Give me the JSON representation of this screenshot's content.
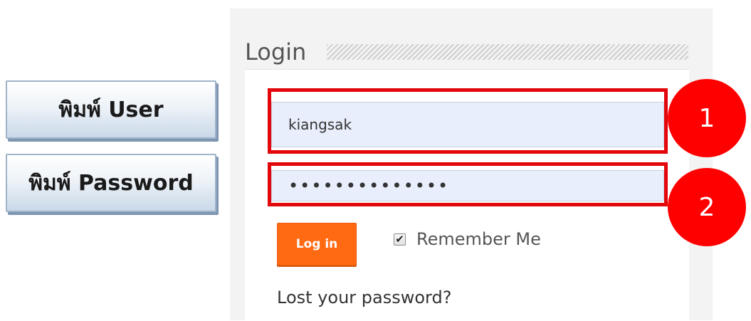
{
  "annotations": {
    "step_user_label": "พิมพ์ User",
    "step_password_label": "พิมพ์ Password",
    "badge_1": "1",
    "badge_2": "2"
  },
  "login_widget": {
    "title": "Login",
    "username_value": "kiangsak",
    "password_value": "••••••••••••••",
    "login_button_label": "Log in",
    "remember_me_label": "Remember Me",
    "remember_me_checked": true,
    "checkbox_glyph": "✔",
    "lost_password_label": "Lost your password?"
  },
  "colors": {
    "highlight": "#e3060b",
    "badge": "#ff0000",
    "login_button": "#ff6a13",
    "input_background": "#e8eefb"
  }
}
